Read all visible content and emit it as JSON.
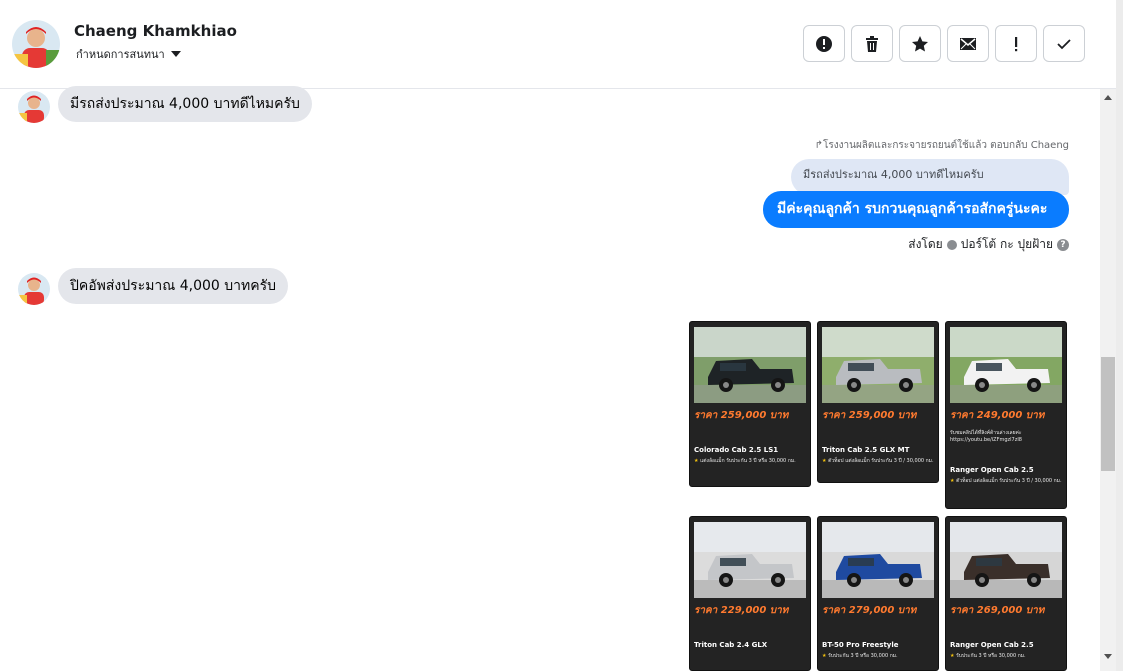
{
  "header": {
    "name": "Chaeng Khamkhiao",
    "subtitle": "กำหนดการสนทนา"
  },
  "toolbar": {
    "buttons": [
      "alert-icon",
      "trash-icon",
      "star-icon",
      "envelope-icon",
      "exclamation-icon",
      "check-icon"
    ]
  },
  "messages": {
    "m1": "มีรถส่งประมาณ 4,000 บาทดีไหมครับ",
    "reply_note": "↱โรงงานผลิตและกระจายรถยนต์ใช้แล้ว ตอบกลับ Chaeng",
    "quoted": "มีรถส่งประมาณ 4,000 บาทดีไหมครับ",
    "m2": "มีค่ะคุณลูกค้า รบกวนคุณลูกค้ารอสักครู่นะคะ",
    "sent_by_label": "ส่งโดย",
    "sent_by_name": "ปอร์โต้ กะ ปุยฝ้าย",
    "m3": "ปิคอัพส่งประมาณ 4,000 บาทครับ"
  },
  "colors": {
    "accent": "#0a7cff",
    "incoming_bubble": "#e4e6eb",
    "card_bg": "#232323",
    "price": "#ff7a2f"
  },
  "cards": [
    {
      "price": "ราคา 259,000 บาท",
      "model": "Colorado Cab 2.5 LS1",
      "warranty": "แต่งล้อแม็ก รับประกัน 3 ปี หรือ 30,000 กม.",
      "car_color": "#1e2326",
      "bg": "#7f9e6a"
    },
    {
      "price": "ราคา 259,000 บาท",
      "model": "Triton Cab 2.5 GLX MT",
      "warranty": "ตัวท็อป แต่งล้อแม็ก รับประกัน 3 ปี / 30,000 กม.",
      "car_color": "#b9bcc0",
      "bg": "#8fae6c"
    },
    {
      "price": "ราคา 249,000 บาท",
      "model": "Ranger Open Cab 2.5",
      "link": "รับชมคลิปได้ที่ลิงค์ด้านล่างเลยค่ะ https://youtu.be/iZFmgzl7zI8",
      "warranty": "ตัวท็อป แต่งล้อแม็ก รับประกัน 3 ปี / 30,000 กม.",
      "car_color": "#f2f2f2",
      "bg": "#83a763"
    },
    {
      "price": "ราคา 229,000 บาท",
      "model": "Triton Cab 2.4 GLX",
      "warranty": "",
      "car_color": "#c4c6c9",
      "bg": "#dcdcdc"
    },
    {
      "price": "ราคา 279,000 บาท",
      "model": "BT-50 Pro Freestyle",
      "warranty": "รับประกัน 3 ปี หรือ 30,000 กม.",
      "car_color": "#1f4aa0",
      "bg": "#d9d9d9"
    },
    {
      "price": "ราคา 269,000 บาท",
      "model": "Ranger Open Cab 2.5",
      "warranty": "รับประกัน 3 ปี หรือ 30,000 กม.",
      "car_color": "#3a2f2a",
      "bg": "#d6d6d6"
    }
  ]
}
